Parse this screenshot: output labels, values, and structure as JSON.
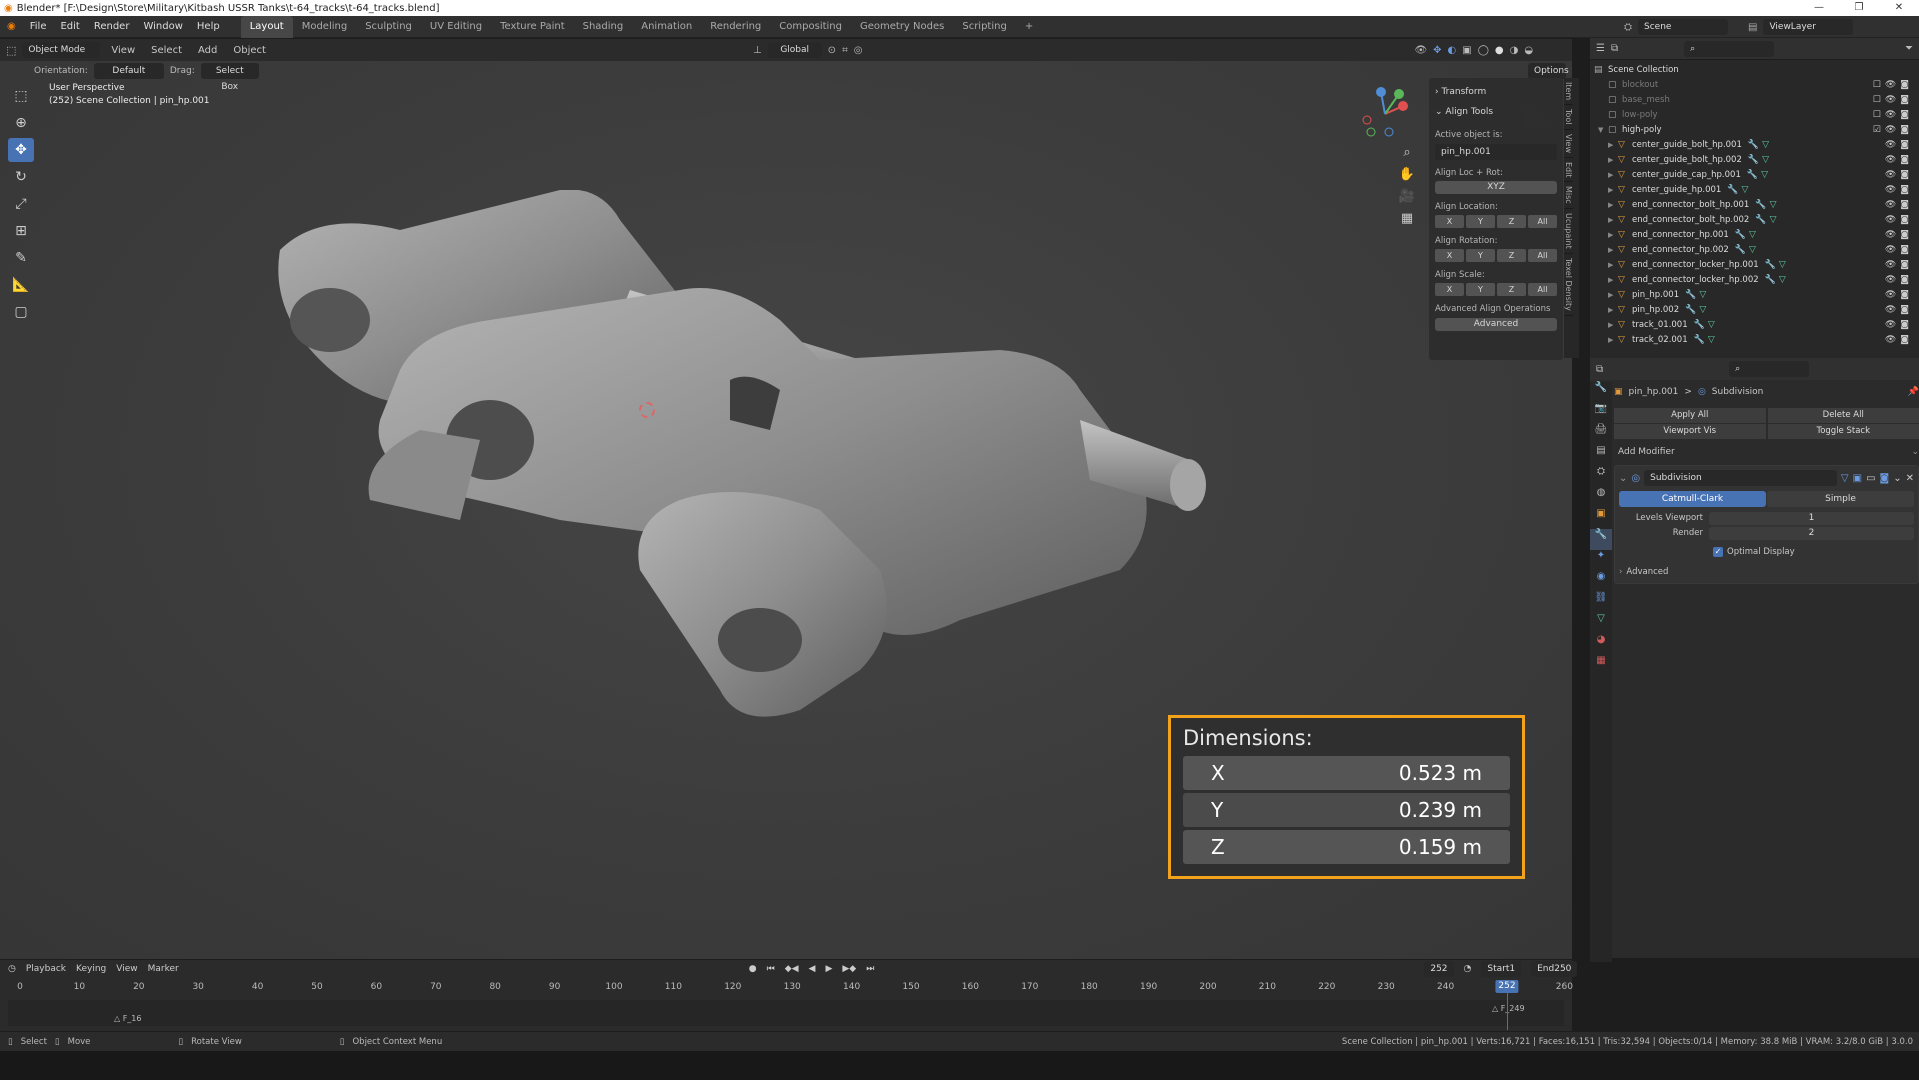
{
  "title_bar": {
    "text": "Blender* [F:\\Design\\Store\\Military\\Kitbash USSR Tanks\\t-64_tracks\\t-64_tracks.blend]"
  },
  "menu": {
    "items": [
      "File",
      "Edit",
      "Render",
      "Window",
      "Help"
    ]
  },
  "workspaces": {
    "tabs": [
      "Layout",
      "Modeling",
      "Sculpting",
      "UV Editing",
      "Texture Paint",
      "Shading",
      "Animation",
      "Rendering",
      "Compositing",
      "Geometry Nodes",
      "Scripting"
    ],
    "add": "+"
  },
  "scene": {
    "name": "Scene",
    "view_layer": "ViewLayer"
  },
  "viewport": {
    "mode": "Object Mode",
    "menus": [
      "View",
      "Select",
      "Add",
      "Object"
    ],
    "transform_orientation": "Global",
    "orientation_label": "Orientation:",
    "orientation_value": "Default",
    "drag_label": "Drag:",
    "drag_value": "Select Box",
    "options": "Options",
    "overlay_title": "User Perspective",
    "overlay_sub": "(252) Scene Collection | pin_hp.001"
  },
  "npanel": {
    "transform": "Transform",
    "align_tools": "Align Tools",
    "active_object_is": "Active object is:",
    "active_object": "pin_hp.001",
    "align_loc_rot": "Align Loc + Rot:",
    "xyz": "XYZ",
    "align_location": "Align Location:",
    "align_rotation": "Align Rotation:",
    "align_scale": "Align Scale:",
    "axes": [
      "X",
      "Y",
      "Z",
      "All"
    ],
    "advanced_ops": "Advanced Align Operations",
    "advanced": "Advanced",
    "tabs": [
      "Item",
      "Tool",
      "View",
      "Edit",
      "Misc",
      "Ucupaint",
      "Texel Density"
    ]
  },
  "dimensions": {
    "title": "Dimensions:",
    "rows": [
      {
        "axis": "X",
        "value": "0.523 m"
      },
      {
        "axis": "Y",
        "value": "0.239 m"
      },
      {
        "axis": "Z",
        "value": "0.159 m"
      }
    ]
  },
  "outliner": {
    "root": "Scene Collection",
    "collections": [
      {
        "name": "blockout",
        "dim": true
      },
      {
        "name": "base_mesh",
        "dim": true
      },
      {
        "name": "low-poly",
        "dim": true
      },
      {
        "name": "high-poly",
        "dim": false
      }
    ],
    "objects": [
      "center_guide_bolt_hp.001",
      "center_guide_bolt_hp.002",
      "center_guide_cap_hp.001",
      "center_guide_hp.001",
      "end_connector_bolt_hp.001",
      "end_connector_bolt_hp.002",
      "end_connector_hp.001",
      "end_connector_hp.002",
      "end_connector_locker_hp.001",
      "end_connector_locker_hp.002",
      "pin_hp.001",
      "pin_hp.002",
      "track_01.001",
      "track_02.001"
    ]
  },
  "properties": {
    "breadcrumb_object": "pin_hp.001",
    "breadcrumb_sep": ">",
    "breadcrumb_modifier": "Subdivision",
    "apply_all": "Apply All",
    "delete_all": "Delete All",
    "viewport_vis": "Viewport Vis",
    "toggle_stack": "Toggle Stack",
    "add_modifier": "Add Modifier",
    "modifier_name": "Subdivision",
    "catmull": "Catmull-Clark",
    "simple": "Simple",
    "levels_viewport_label": "Levels Viewport",
    "levels_viewport": "1",
    "render_label": "Render",
    "render_value": "2",
    "optimal_display": "Optimal Display",
    "advanced": "Advanced"
  },
  "timeline": {
    "menus": [
      "Playback",
      "Keying",
      "View",
      "Marker"
    ],
    "current_frame": "252",
    "start_label": "Start",
    "start": "1",
    "end_label": "End",
    "end": "250",
    "ruler": [
      "0",
      "10",
      "20",
      "30",
      "40",
      "50",
      "60",
      "70",
      "80",
      "90",
      "100",
      "110",
      "120",
      "130",
      "140",
      "150",
      "160",
      "170",
      "180",
      "190",
      "200",
      "210",
      "220",
      "230",
      "240",
      "250",
      "260"
    ],
    "playhead": "252",
    "marker_f16": "F_16",
    "marker_f249": "F_249"
  },
  "statusbar": {
    "select": "Select",
    "move": "Move",
    "rotate": "Rotate View",
    "context": "Object Context Menu",
    "stats": "Scene Collection | pin_hp.001 | Verts:16,721 | Faces:16,151 | Tris:32,594 | Objects:0/14 | Memory: 38.8 MiB | VRAM: 3.2/8.0 GiB | 3.0.0"
  },
  "colors": {
    "accent": "#4772b3",
    "highlight": "#f2a31b",
    "object_icon": "#e39a3b"
  }
}
